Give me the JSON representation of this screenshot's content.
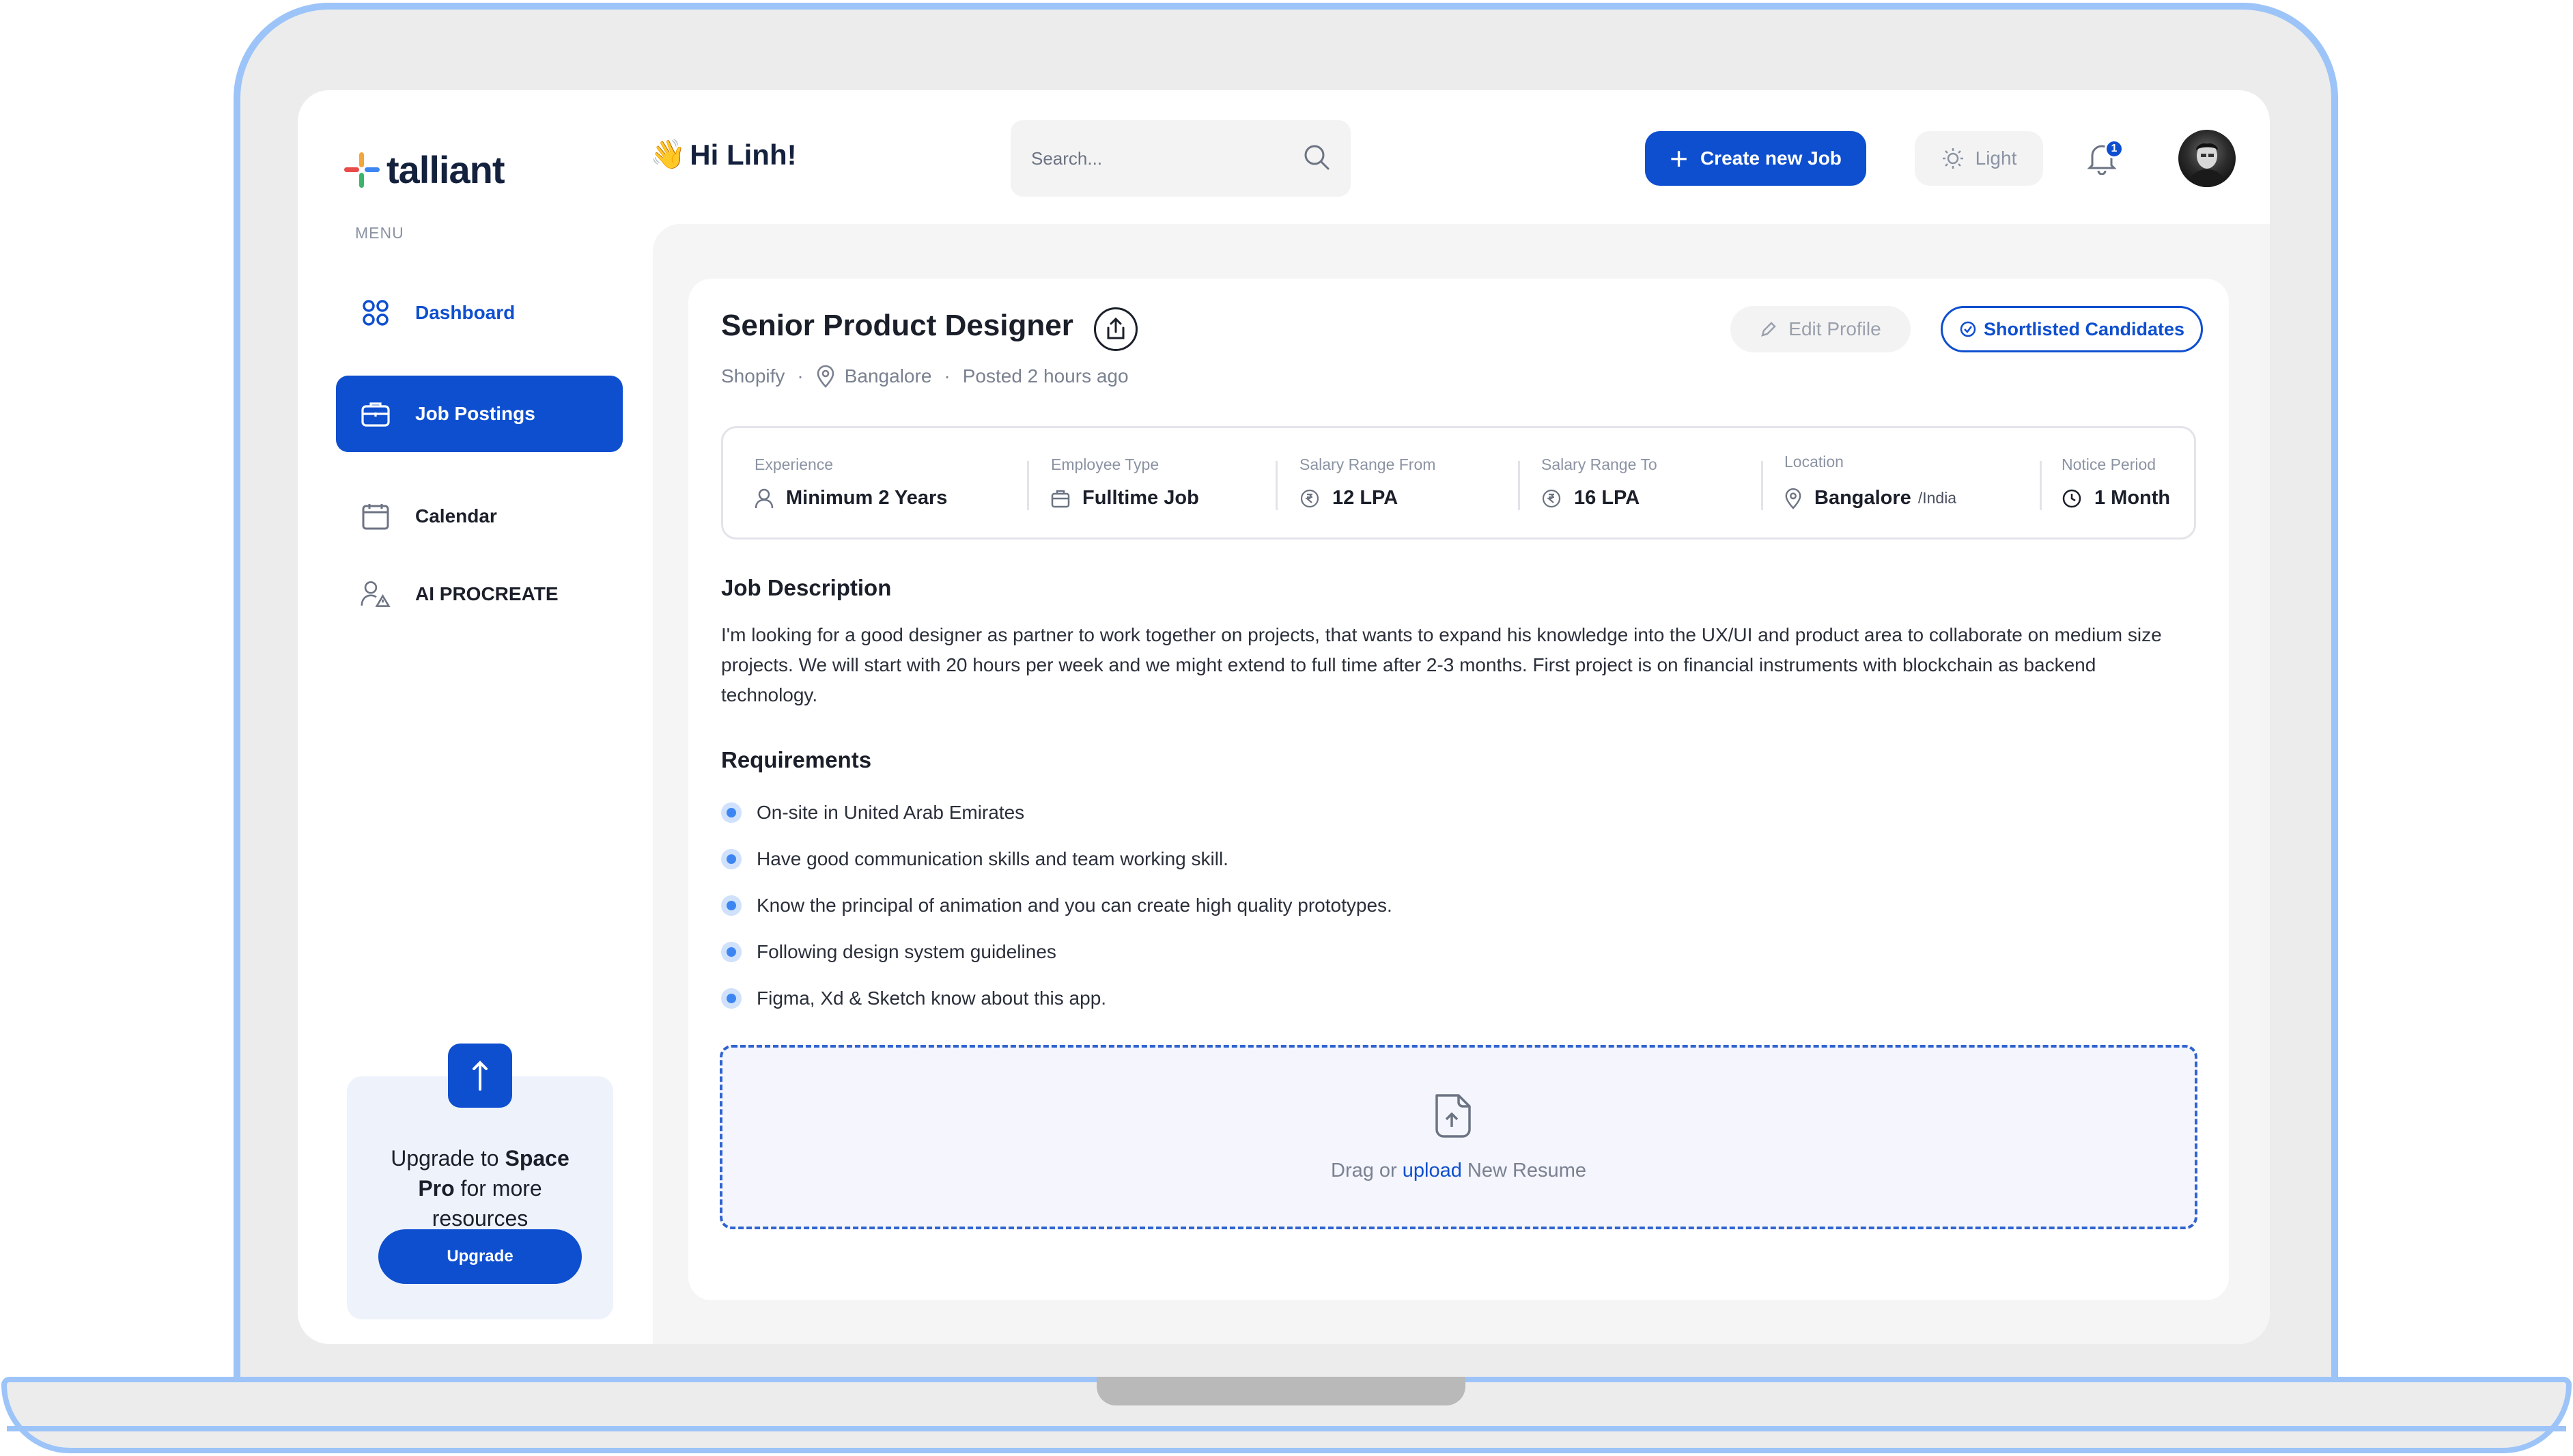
{
  "app": {
    "logo_text": "talliant",
    "menu_label": "MENU"
  },
  "sidebar": {
    "items": [
      {
        "label": "Dashboard",
        "icon": "grid-icon",
        "state": "active-text"
      },
      {
        "label": "Job Postings",
        "icon": "briefcase-icon",
        "state": "selected"
      },
      {
        "label": "Calendar",
        "icon": "calendar-icon",
        "state": "default"
      },
      {
        "label": "AI PROCREATE",
        "icon": "user-warning-icon",
        "state": "default"
      }
    ],
    "upgrade": {
      "text_prefix": "Upgrade to ",
      "text_bold": "Space Pro",
      "text_suffix": " for more resources",
      "button_label": "Upgrade"
    }
  },
  "header": {
    "greeting_emoji": "👋",
    "greeting": "Hi Linh!",
    "search_placeholder": "Search...",
    "create_button_label": "Create new Job",
    "theme_label": "Light",
    "notification_count": "1"
  },
  "job": {
    "title": "Senior Product Designer",
    "company": "Shopify",
    "location": "Bangalore",
    "posted": "Posted 2 hours ago",
    "edit_label": "Edit Profile",
    "shortlisted_label": "Shortlisted Candidates",
    "details": [
      {
        "label": "Experience",
        "value": "Minimum 2 Years",
        "icon": "user-icon"
      },
      {
        "label": "Employee Type",
        "value": "Fulltime Job",
        "icon": "briefcase-icon"
      },
      {
        "label": "Salary Range From",
        "value": "12 LPA",
        "icon": "rupee-icon"
      },
      {
        "label": "Salary Range To",
        "value": "16 LPA",
        "icon": "rupee-icon"
      },
      {
        "label": "Location",
        "value": "Bangalore",
        "suffix": "/India",
        "icon": "pin-icon"
      },
      {
        "label": "Notice Period",
        "value": "1 Month",
        "icon": "clock-icon"
      }
    ],
    "description_heading": "Job Description",
    "description": "I'm looking for a good designer as partner to work together on projects, that wants to expand his knowledge into the UX/UI and product area to collaborate on medium size projects. We will start with 20 hours per week and we might extend to full time after 2-3 months. First project is on financial instruments with blockchain as backend technology.",
    "requirements_heading": "Requirements",
    "requirements": [
      "On-site in United Arab Emirates",
      "Have good communication skills and team working skill.",
      "Know the principal of animation and you can create high quality prototypes.",
      "Following design system guidelines",
      "Figma, Xd & Sketch know about this app."
    ],
    "upload": {
      "prefix": "Drag or ",
      "link": "upload",
      "suffix": " New Resume"
    }
  },
  "colors": {
    "primary": "#0e4fcf",
    "frame": "#9cc4f8",
    "bullet": "#3d86f2"
  }
}
